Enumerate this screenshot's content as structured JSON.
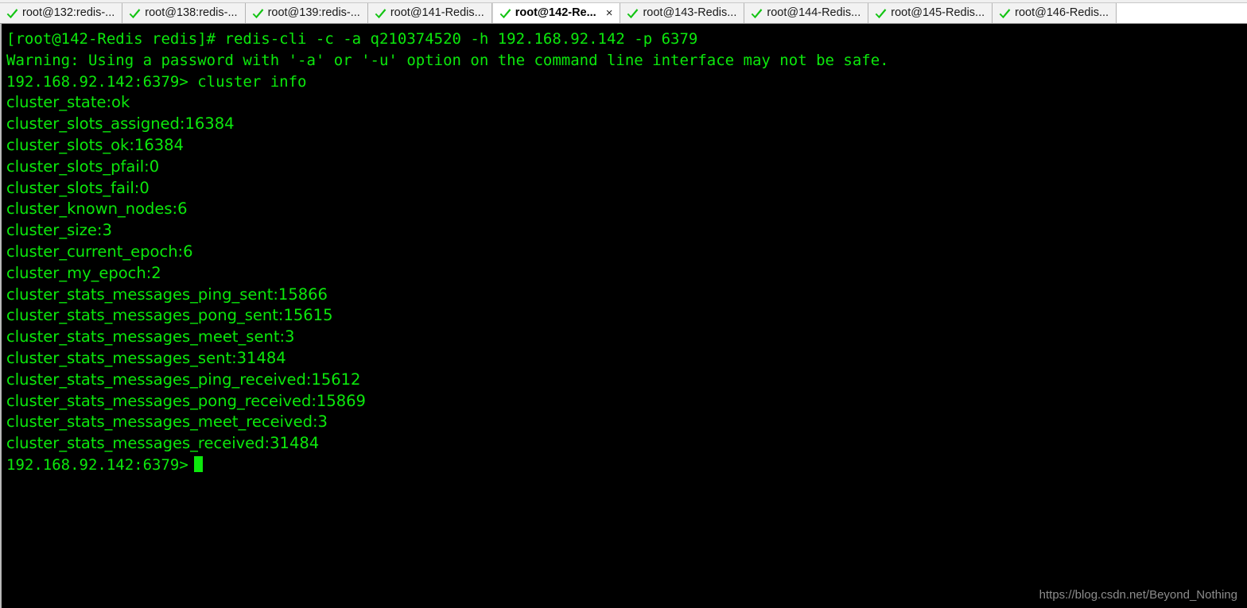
{
  "window": {
    "title": "root@142-Redis",
    "background_color": "#000000",
    "chrome_color": "#f2f2f2"
  },
  "tabs": {
    "icon_name": "green-check-icon",
    "icon_color": "#13c413",
    "close_label": "×",
    "items": [
      {
        "label": "root@132:redis-...",
        "active": false,
        "closable": false
      },
      {
        "label": "root@138:redis-...",
        "active": false,
        "closable": false
      },
      {
        "label": "root@139:redis-...",
        "active": false,
        "closable": false
      },
      {
        "label": "root@141-Redis...",
        "active": false,
        "closable": false
      },
      {
        "label": "root@142-Re...",
        "active": true,
        "closable": true
      },
      {
        "label": "root@143-Redis...",
        "active": false,
        "closable": false
      },
      {
        "label": "root@144-Redis...",
        "active": false,
        "closable": false
      },
      {
        "label": "root@145-Redis...",
        "active": false,
        "closable": false
      },
      {
        "label": "root@146-Redis...",
        "active": false,
        "closable": false
      }
    ]
  },
  "terminal": {
    "text_color": "#0ce80c",
    "background_color": "#000000",
    "lines": [
      {
        "text": "[root@142-Redis redis]# redis-cli -c -a q210374520 -h 192.168.92.142 -p 6379",
        "style": "mono"
      },
      {
        "text": "Warning: Using a password with '-a' or '-u' option on the command line interface may not be safe.",
        "style": "mono"
      },
      {
        "text": "192.168.92.142:6379> cluster info",
        "style": "mono"
      },
      {
        "text": "cluster_state:ok",
        "style": "prop"
      },
      {
        "text": "cluster_slots_assigned:16384",
        "style": "prop"
      },
      {
        "text": "cluster_slots_ok:16384",
        "style": "prop"
      },
      {
        "text": "cluster_slots_pfail:0",
        "style": "prop"
      },
      {
        "text": "cluster_slots_fail:0",
        "style": "prop"
      },
      {
        "text": "cluster_known_nodes:6",
        "style": "prop"
      },
      {
        "text": "cluster_size:3",
        "style": "prop"
      },
      {
        "text": "cluster_current_epoch:6",
        "style": "prop"
      },
      {
        "text": "cluster_my_epoch:2",
        "style": "prop"
      },
      {
        "text": "cluster_stats_messages_ping_sent:15866",
        "style": "prop"
      },
      {
        "text": "cluster_stats_messages_pong_sent:15615",
        "style": "prop"
      },
      {
        "text": "cluster_stats_messages_meet_sent:3",
        "style": "prop"
      },
      {
        "text": "cluster_stats_messages_sent:31484",
        "style": "prop"
      },
      {
        "text": "cluster_stats_messages_ping_received:15612",
        "style": "prop"
      },
      {
        "text": "cluster_stats_messages_pong_received:15869",
        "style": "prop"
      },
      {
        "text": "cluster_stats_messages_meet_received:3",
        "style": "prop"
      },
      {
        "text": "cluster_stats_messages_received:31484",
        "style": "prop"
      }
    ],
    "prompt": "192.168.92.142:6379>",
    "cursor": "block"
  },
  "watermark": {
    "text": "https://blog.csdn.net/Beyond_Nothing",
    "color": "#8c8c8c"
  }
}
